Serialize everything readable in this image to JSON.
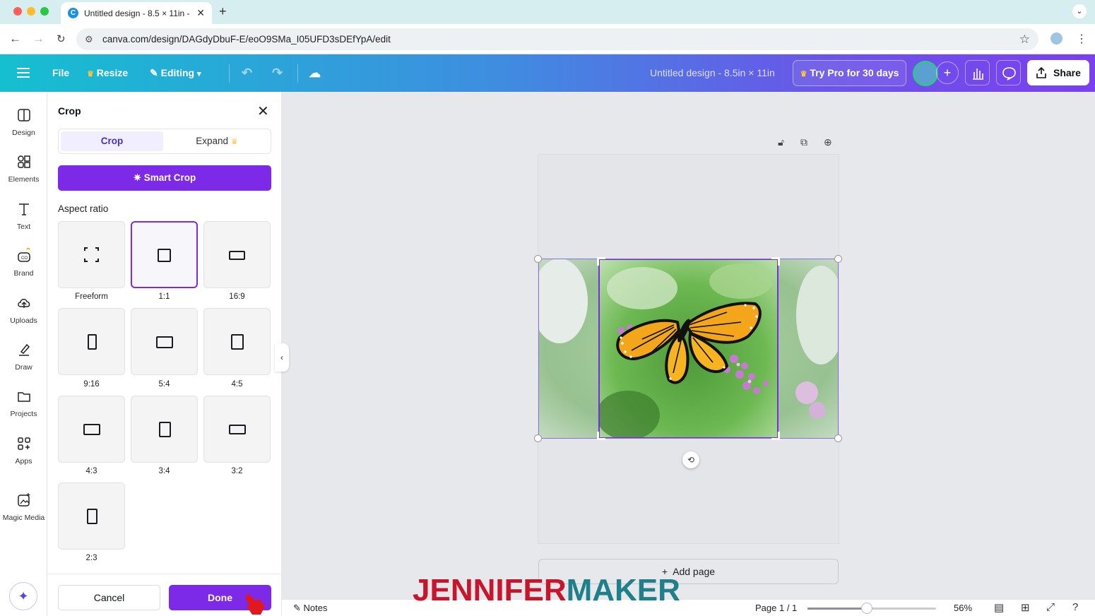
{
  "browser": {
    "tab_title": "Untitled design - 8.5 × 11in -",
    "url": "canva.com/design/DAGdyDbuF-E/eoO9SMa_I05UFD3sDEfYpA/edit",
    "new_tab_symbol": "+",
    "tab_close_symbol": "✕"
  },
  "header": {
    "file_label": "File",
    "resize_label": "Resize",
    "editing_label": "Editing",
    "design_title": "Untitled design - 8.5in × 11in",
    "try_pro_label": "Try Pro for 30 days",
    "share_label": "Share",
    "accent_start": "#15bfd0",
    "accent_end": "#7b3ff0"
  },
  "rail": {
    "items": [
      {
        "label": "Design",
        "icon": "design-icon"
      },
      {
        "label": "Elements",
        "icon": "elements-icon"
      },
      {
        "label": "Text",
        "icon": "text-icon"
      },
      {
        "label": "Brand",
        "icon": "brand-icon"
      },
      {
        "label": "Uploads",
        "icon": "uploads-icon"
      },
      {
        "label": "Draw",
        "icon": "draw-icon"
      },
      {
        "label": "Projects",
        "icon": "projects-icon"
      },
      {
        "label": "Apps",
        "icon": "apps-icon"
      },
      {
        "label": "Magic Media",
        "icon": "magic-media-icon"
      }
    ]
  },
  "crop_panel": {
    "title": "Crop",
    "tab_crop": "Crop",
    "tab_expand": "Expand",
    "smart_crop_label": "Smart Crop",
    "aspect_ratio_label": "Aspect ratio",
    "ratios": [
      "Freeform",
      "1:1",
      "16:9",
      "9:16",
      "5:4",
      "4:5",
      "4:3",
      "3:4",
      "3:2",
      "2:3"
    ],
    "selected_ratio": "1:1",
    "cancel_label": "Cancel",
    "done_label": "Done",
    "brand_purple": "#7d2ae8"
  },
  "canvas": {
    "add_page_label": "Add page"
  },
  "bottom": {
    "notes_label": "Notes",
    "page_indicator": "Page 1 / 1",
    "zoom_label": "56%",
    "zoom_fraction": 0.56
  },
  "watermark": {
    "part1": "JENNIFER",
    "part2": "MAKER"
  }
}
